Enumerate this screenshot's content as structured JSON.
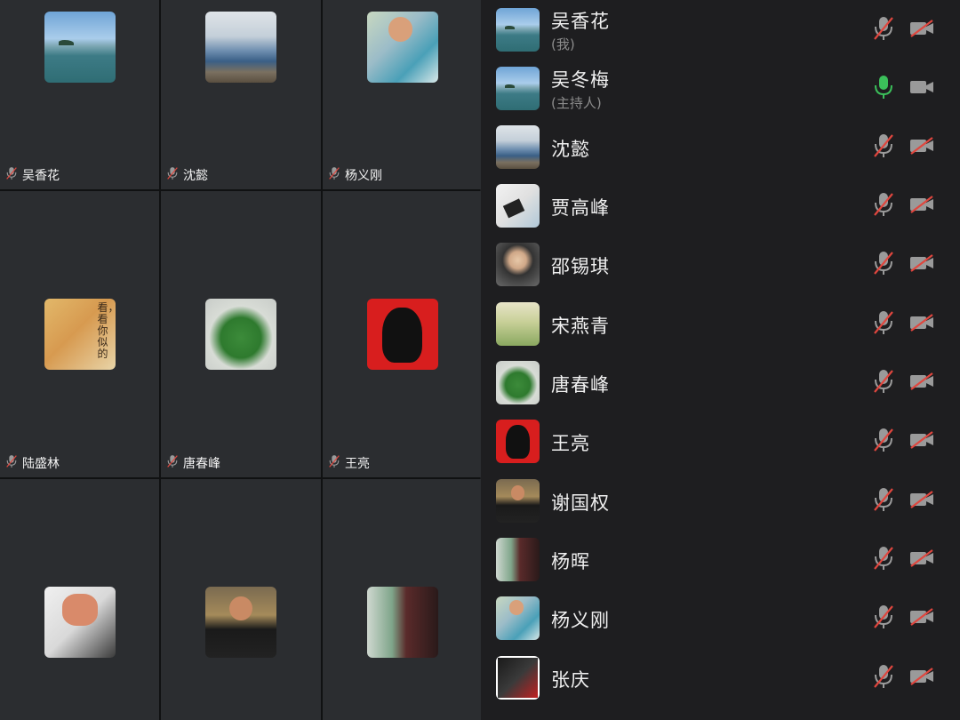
{
  "grid": {
    "tiles": [
      {
        "name": "吴香花",
        "avatar": "sea-icon"
      },
      {
        "name": "沈懿",
        "avatar": "mountain-icon"
      },
      {
        "name": "杨义刚",
        "avatar": "baby-icon"
      },
      {
        "name": "陆盛林",
        "avatar": "cat-icon",
        "avatar_text": "看，看你似的"
      },
      {
        "name": "唐春峰",
        "avatar": "plant-icon"
      },
      {
        "name": "王亮",
        "avatar": "che-icon"
      },
      {
        "name": "",
        "avatar": "anime-icon"
      },
      {
        "name": "",
        "avatar": "man-icon"
      },
      {
        "name": "",
        "avatar": "garden-icon"
      }
    ]
  },
  "members": [
    {
      "name": "吴香花",
      "sub": "(我)",
      "avatar": "sea-icon",
      "mic": "muted",
      "cam": "off"
    },
    {
      "name": "吴冬梅",
      "sub": "(主持人)",
      "avatar": "sea-icon",
      "mic": "on",
      "cam": "on"
    },
    {
      "name": "沈懿",
      "sub": "",
      "avatar": "mountain-icon",
      "mic": "muted",
      "cam": "off"
    },
    {
      "name": "贾高峰",
      "sub": "",
      "avatar": "snow-icon",
      "mic": "muted",
      "cam": "off"
    },
    {
      "name": "邵锡琪",
      "sub": "",
      "avatar": "kid-icon",
      "mic": "muted",
      "cam": "off"
    },
    {
      "name": "宋燕青",
      "sub": "",
      "avatar": "meadow-icon",
      "mic": "muted",
      "cam": "off"
    },
    {
      "name": "唐春峰",
      "sub": "",
      "avatar": "plant-icon",
      "mic": "muted",
      "cam": "off"
    },
    {
      "name": "王亮",
      "sub": "",
      "avatar": "che-icon",
      "mic": "muted",
      "cam": "off"
    },
    {
      "name": "谢国权",
      "sub": "",
      "avatar": "man-icon",
      "mic": "muted",
      "cam": "off"
    },
    {
      "name": "杨晖",
      "sub": "",
      "avatar": "garden-icon",
      "mic": "muted",
      "cam": "off"
    },
    {
      "name": "杨义刚",
      "sub": "",
      "avatar": "baby-icon",
      "mic": "muted",
      "cam": "off"
    },
    {
      "name": "张庆",
      "sub": "",
      "avatar": "bike-icon",
      "mic": "muted",
      "cam": "off"
    }
  ],
  "colors": {
    "muted_red": "#e0463e",
    "active_green": "#3bbf5a",
    "icon_gray": "#9a9a9a"
  }
}
